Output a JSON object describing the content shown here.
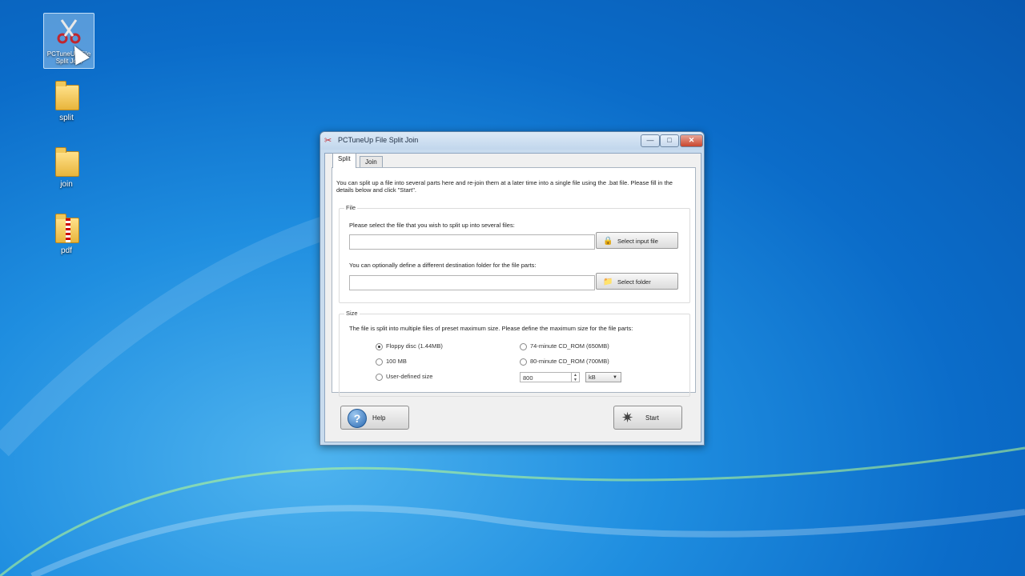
{
  "desktop": {
    "icons": [
      {
        "label": "PCTuneUp File Split Join",
        "type": "shortcut"
      },
      {
        "label": "split",
        "type": "folder"
      },
      {
        "label": "join",
        "type": "folder"
      },
      {
        "label": "pdf",
        "type": "zip-folder"
      }
    ]
  },
  "window": {
    "title": "PCTuneUp File Split Join",
    "buttons": {
      "minimize": "—",
      "maximize": "□",
      "close": "✕"
    }
  },
  "tabs": [
    {
      "label": "Split",
      "active": true
    },
    {
      "label": "Join",
      "active": false
    }
  ],
  "intro": "You can split up a file into several parts here and re-join them at a later time into a single file using the .bat file. Please fill in the details below and click \"Start\".",
  "file_group": {
    "label": "File",
    "input_prompt": "Please select the file that you wish to split up into several files:",
    "input_value": "",
    "select_input_label": "Select input file",
    "dest_prompt": "You can optionally define a different destination folder for the file parts:",
    "dest_value": "",
    "select_folder_label": "Select folder"
  },
  "size_group": {
    "label": "Size",
    "description": "The file is split into multiple files of preset maximum size. Please define the maximum size for the file parts:",
    "options": [
      {
        "label": "Floppy disc (1.44MB)",
        "selected": true
      },
      {
        "label": "74-minute CD_ROM (650MB)",
        "selected": false
      },
      {
        "label": "100 MB",
        "selected": false
      },
      {
        "label": "80-minute CD_ROM (700MB)",
        "selected": false
      },
      {
        "label": "User-defined size",
        "selected": false
      }
    ],
    "user_size_value": "800",
    "unit_value": "kB"
  },
  "actions": {
    "help_label": "Help",
    "start_label": "Start"
  }
}
